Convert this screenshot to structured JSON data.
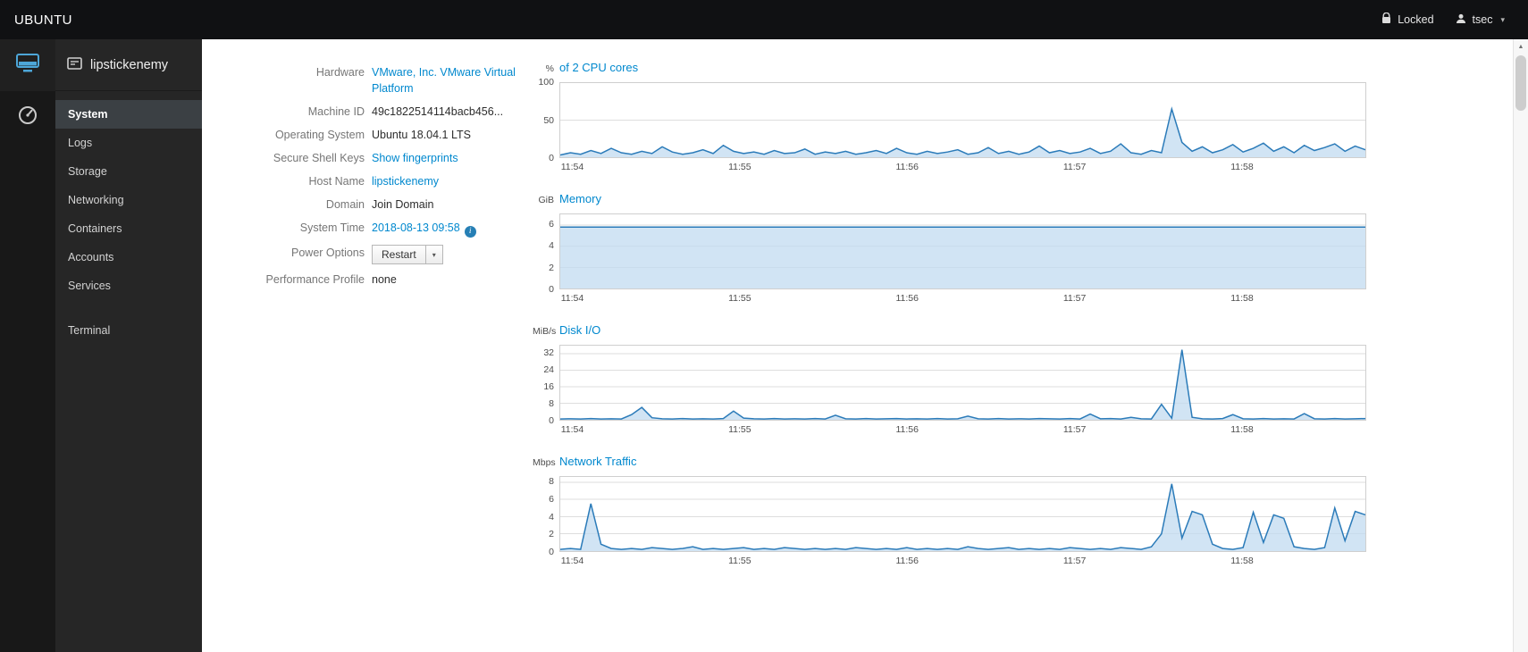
{
  "masthead": {
    "brand": "UBUNTU",
    "locked_label": "Locked",
    "user_name": "tsec"
  },
  "icons": {
    "caret_glyph": "▾",
    "info_glyph": "i",
    "scroll_up_glyph": "▲"
  },
  "colors": {
    "link": "#0088ce",
    "chart_line": "#2b7bb9",
    "chart_fill": "#c2dbf0",
    "sidebar_bg": "#262626",
    "masthead_bg": "#101113"
  },
  "sidebar": {
    "host_name": "lipstickenemy",
    "items": [
      {
        "label": "System",
        "active": true
      },
      {
        "label": "Logs",
        "active": false
      },
      {
        "label": "Storage",
        "active": false
      },
      {
        "label": "Networking",
        "active": false
      },
      {
        "label": "Containers",
        "active": false
      },
      {
        "label": "Accounts",
        "active": false
      },
      {
        "label": "Services",
        "active": false
      },
      {
        "label": "Terminal",
        "active": false,
        "gap_before": true
      }
    ]
  },
  "system_info": {
    "rows": [
      {
        "label": "Hardware",
        "kind": "link",
        "value": "VMware, Inc. VMware Virtual Platform"
      },
      {
        "label": "Machine ID",
        "kind": "text",
        "value": "49c1822514114bacb456..."
      },
      {
        "label": "Operating System",
        "kind": "text",
        "value": "Ubuntu 18.04.1 LTS"
      },
      {
        "label": "Secure Shell Keys",
        "kind": "link",
        "value": "Show fingerprints"
      },
      {
        "label": "Host Name",
        "kind": "link",
        "value": "lipstickenemy"
      },
      {
        "label": "Domain",
        "kind": "action",
        "value": "Join Domain"
      },
      {
        "label": "System Time",
        "kind": "link-info",
        "value": "2018-08-13 09:58"
      },
      {
        "label": "Power Options",
        "kind": "split-button",
        "value": "Restart"
      },
      {
        "label": "Performance Profile",
        "kind": "text",
        "value": "none"
      }
    ]
  },
  "chart_data": [
    {
      "type": "area",
      "unit": "%",
      "title": "of 2 CPU cores",
      "ymax": 100,
      "yticks": [
        0,
        50,
        100
      ],
      "xticks": [
        "11:54",
        "11:55",
        "11:56",
        "11:57",
        "11:58"
      ],
      "values": [
        3,
        6,
        4,
        9,
        5,
        12,
        6,
        4,
        8,
        5,
        14,
        7,
        4,
        6,
        10,
        5,
        16,
        8,
        5,
        7,
        4,
        9,
        5,
        6,
        11,
        4,
        7,
        5,
        8,
        4,
        6,
        9,
        5,
        12,
        6,
        4,
        8,
        5,
        7,
        10,
        4,
        6,
        13,
        5,
        8,
        4,
        7,
        15,
        6,
        9,
        5,
        7,
        12,
        5,
        8,
        18,
        6,
        4,
        9,
        6,
        65,
        20,
        8,
        14,
        6,
        10,
        17,
        7,
        12,
        19,
        8,
        14,
        6,
        16,
        9,
        13,
        18,
        8,
        15,
        10
      ]
    },
    {
      "type": "area",
      "unit": "GiB",
      "title": "Memory",
      "ymax": 7,
      "yticks": [
        0,
        2,
        4,
        6
      ],
      "xticks": [
        "11:54",
        "11:55",
        "11:56",
        "11:57",
        "11:58"
      ],
      "values": [
        5.8,
        5.8,
        5.8,
        5.8,
        5.8,
        5.8,
        5.8,
        5.8,
        5.8,
        5.8,
        5.8,
        5.8
      ]
    },
    {
      "type": "area",
      "unit": "MiB/s",
      "title": "Disk I/O",
      "ymax": 36,
      "yticks": [
        0,
        8,
        16,
        24,
        32
      ],
      "xticks": [
        "11:54",
        "11:55",
        "11:56",
        "11:57",
        "11:58"
      ],
      "values": [
        0.4,
        0.5,
        0.4,
        0.6,
        0.4,
        0.5,
        0.4,
        2.5,
        6,
        1,
        0.5,
        0.4,
        0.6,
        0.4,
        0.5,
        0.4,
        0.6,
        4.2,
        0.8,
        0.5,
        0.4,
        0.6,
        0.4,
        0.5,
        0.4,
        0.6,
        0.4,
        2.2,
        0.5,
        0.4,
        0.6,
        0.4,
        0.5,
        0.6,
        0.4,
        0.5,
        0.4,
        0.6,
        0.4,
        0.5,
        1.8,
        0.5,
        0.4,
        0.6,
        0.4,
        0.5,
        0.4,
        0.6,
        0.5,
        0.4,
        0.6,
        0.4,
        2.8,
        0.5,
        0.6,
        0.4,
        1.2,
        0.5,
        0.4,
        7.5,
        0.8,
        34,
        1.2,
        0.5,
        0.4,
        0.6,
        2.5,
        0.5,
        0.4,
        0.6,
        0.4,
        0.5,
        0.4,
        3,
        0.5,
        0.4,
        0.6,
        0.4,
        0.5,
        0.6
      ]
    },
    {
      "type": "area",
      "unit": "Mbps",
      "title": "Network Traffic",
      "ymax": 8.6,
      "yticks": [
        0,
        2,
        4,
        6,
        8
      ],
      "xticks": [
        "11:54",
        "11:55",
        "11:56",
        "11:57",
        "11:58"
      ],
      "values": [
        0.2,
        0.3,
        0.2,
        5.5,
        0.8,
        0.3,
        0.2,
        0.3,
        0.2,
        0.4,
        0.3,
        0.2,
        0.3,
        0.5,
        0.2,
        0.3,
        0.2,
        0.3,
        0.4,
        0.2,
        0.3,
        0.2,
        0.4,
        0.3,
        0.2,
        0.3,
        0.2,
        0.3,
        0.2,
        0.4,
        0.3,
        0.2,
        0.3,
        0.2,
        0.4,
        0.2,
        0.3,
        0.2,
        0.3,
        0.2,
        0.5,
        0.3,
        0.2,
        0.3,
        0.4,
        0.2,
        0.3,
        0.2,
        0.3,
        0.2,
        0.4,
        0.3,
        0.2,
        0.3,
        0.2,
        0.4,
        0.3,
        0.2,
        0.5,
        2,
        7.8,
        1.5,
        4.6,
        4.2,
        0.8,
        0.3,
        0.2,
        0.4,
        4.5,
        1,
        4.2,
        3.8,
        0.5,
        0.3,
        0.2,
        0.4,
        5,
        1.2,
        4.6,
        4.2
      ]
    }
  ]
}
